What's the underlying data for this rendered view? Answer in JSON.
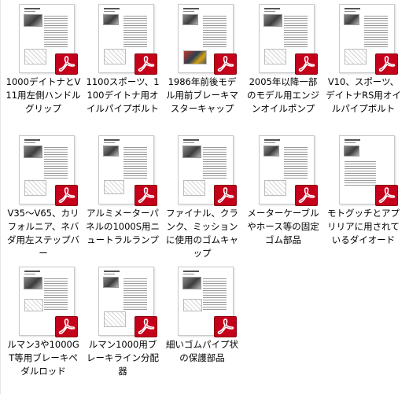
{
  "files": [
    {
      "name": "1000デイトナとV11用左側ハンドルグリップ",
      "type_icon": "pdf-icon"
    },
    {
      "name": "1100スポーツ、1100デイトナ用オイルパイプボルト",
      "type_icon": "pdf-icon"
    },
    {
      "name": "1986年前後モデル用前ブレーキマスターキャップ",
      "type_icon": "pdf-icon"
    },
    {
      "name": "2005年以降一部のモデル用エンジンオイルポンプ",
      "type_icon": "pdf-icon"
    },
    {
      "name": "V10、スポーツ、デイトナRS用オイルパイプボルト",
      "type_icon": "pdf-icon"
    },
    {
      "name": "V35～V65、カリフォルニア、ネバダ用左ステップバー",
      "type_icon": "pdf-icon"
    },
    {
      "name": "アルミメーターパネルの1000S用ニュートラルランプ",
      "type_icon": "pdf-icon"
    },
    {
      "name": "ファイナル、クランク、ミッションに使用のゴムキャップ",
      "type_icon": "pdf-icon"
    },
    {
      "name": "メーターケーブルやホース等の固定ゴム部品",
      "type_icon": "pdf-icon"
    },
    {
      "name": "モトグッチとアプリリアに用されているダイオード",
      "type_icon": "pdf-icon"
    },
    {
      "name": "ルマン3や1000GT等用ブレーキペダルロッド",
      "type_icon": "pdf-icon"
    },
    {
      "name": "ルマン1000用ブレーキライン分配器",
      "type_icon": "pdf-icon"
    },
    {
      "name": "細いゴムパイプ状の保護部品",
      "type_icon": "pdf-icon"
    }
  ]
}
